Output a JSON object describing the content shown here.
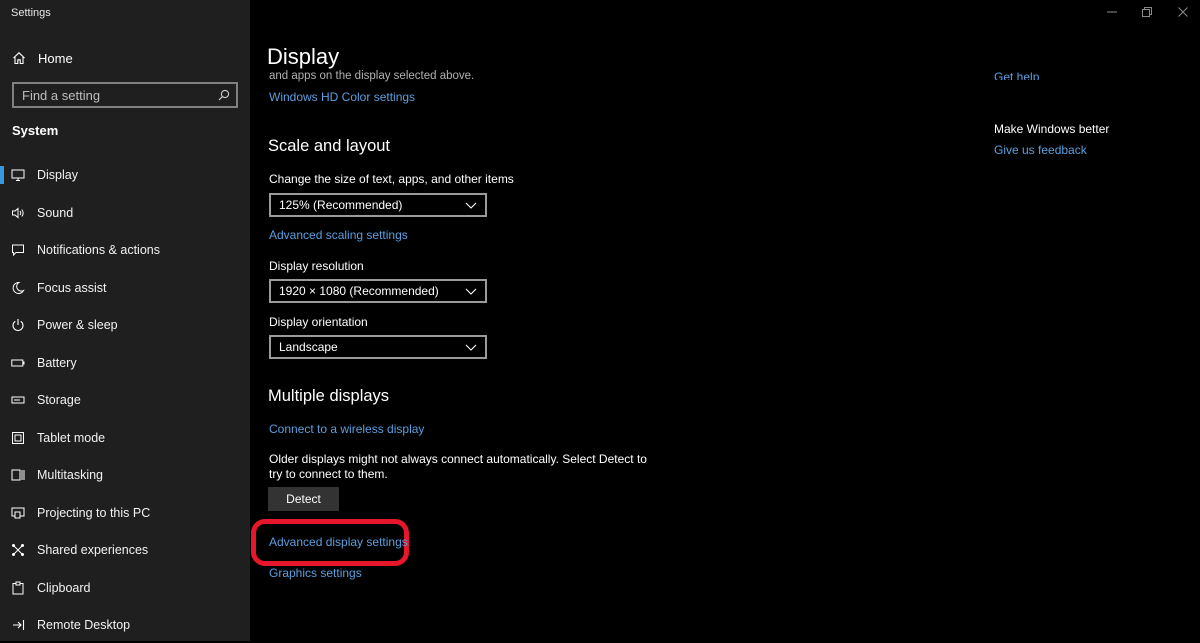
{
  "app": {
    "title": "Settings"
  },
  "sidebar": {
    "home_label": "Home",
    "search_placeholder": "Find a setting",
    "section": "System",
    "items": [
      {
        "label": "Display",
        "icon": "monitor-icon",
        "active": true
      },
      {
        "label": "Sound",
        "icon": "speaker-icon"
      },
      {
        "label": "Notifications & actions",
        "icon": "message-icon"
      },
      {
        "label": "Focus assist",
        "icon": "moon-icon"
      },
      {
        "label": "Power & sleep",
        "icon": "power-icon"
      },
      {
        "label": "Battery",
        "icon": "battery-icon"
      },
      {
        "label": "Storage",
        "icon": "storage-icon"
      },
      {
        "label": "Tablet mode",
        "icon": "tablet-icon"
      },
      {
        "label": "Multitasking",
        "icon": "multitasking-icon"
      },
      {
        "label": "Projecting to this PC",
        "icon": "projector-icon"
      },
      {
        "label": "Shared experiences",
        "icon": "share-icon"
      },
      {
        "label": "Clipboard",
        "icon": "clipboard-icon"
      },
      {
        "label": "Remote Desktop",
        "icon": "remote-desktop-icon"
      }
    ]
  },
  "main": {
    "title": "Display",
    "clipped_text": "and apps on the display selected above.",
    "hd_color_link": "Windows HD Color settings",
    "scale_heading": "Scale and layout",
    "scale_label": "Change the size of text, apps, and other items",
    "scale_value": "125% (Recommended)",
    "advanced_scaling_link": "Advanced scaling settings",
    "resolution_label": "Display resolution",
    "resolution_value": "1920 × 1080 (Recommended)",
    "orientation_label": "Display orientation",
    "orientation_value": "Landscape",
    "multiple_heading": "Multiple displays",
    "wireless_link": "Connect to a wireless display",
    "older_text_1": "Older displays might not always connect automatically. Select Detect to",
    "older_text_2": "try to connect to them.",
    "detect_label": "Detect",
    "advanced_display_link": "Advanced display settings",
    "graphics_link": "Graphics settings"
  },
  "right": {
    "get_help": "Get help",
    "make_better": "Make Windows better",
    "feedback": "Give us feedback"
  },
  "colors": {
    "accent": "#3a96dd",
    "link": "#5b9fe0",
    "highlight": "#e6172a"
  }
}
